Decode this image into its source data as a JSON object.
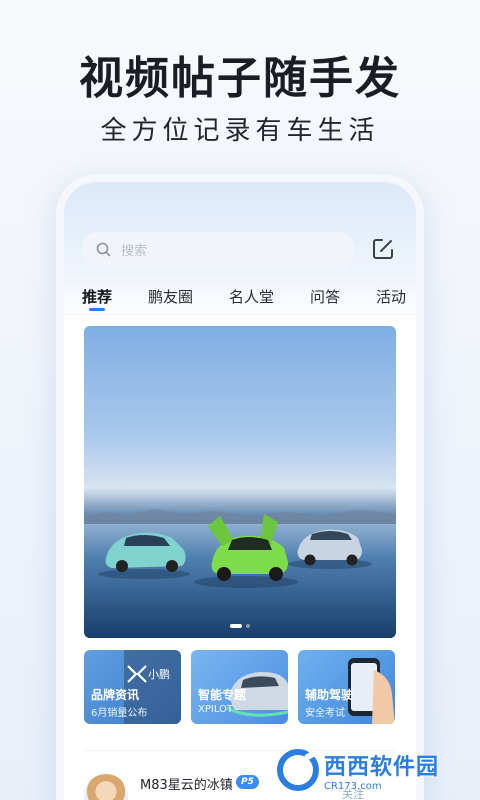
{
  "promo": {
    "headline": "视频帖子随手发",
    "subline": "全方位记录有车生活"
  },
  "search": {
    "placeholder": "搜索"
  },
  "tabs": [
    {
      "label": "推荐",
      "active": true
    },
    {
      "label": "鹏友圈",
      "active": false
    },
    {
      "label": "名人堂",
      "active": false
    },
    {
      "label": "问答",
      "active": false
    },
    {
      "label": "活动",
      "active": false
    }
  ],
  "banner": {
    "slide_count": 2,
    "active_slide": 1
  },
  "cards": [
    {
      "title": "品牌资讯",
      "subtitle": "6月销量公布",
      "brand_mark": "小鹏"
    },
    {
      "title": "智能专题",
      "subtitle": "XPILOT"
    },
    {
      "title": "辅助驾驶",
      "subtitle": "安全考试"
    }
  ],
  "post": {
    "username": "M83星云的冰镇",
    "badge": "P5",
    "follow_label": "关注"
  },
  "watermark": {
    "title": "西西软件园",
    "subtitle": "CR173.com"
  },
  "colors": {
    "accent": "#2f7cf6",
    "badge": "#3a8cf7"
  }
}
